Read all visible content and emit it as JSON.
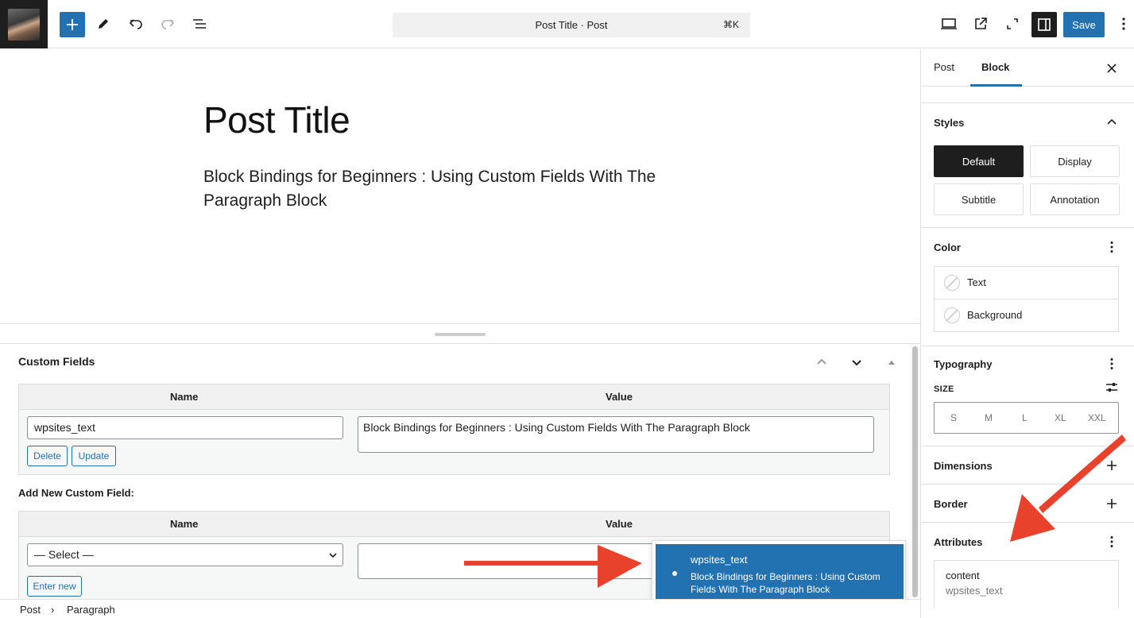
{
  "toolbar": {
    "command_title": "Post Title · Post",
    "command_shortcut": "⌘K",
    "save_label": "Save"
  },
  "editor": {
    "post_title": "Post Title",
    "paragraph": "Block Bindings for Beginners : Using Custom Fields With The Paragraph Block"
  },
  "metabox": {
    "title": "Custom Fields",
    "name_header": "Name",
    "value_header": "Value",
    "existing_field": {
      "name": "wpsites_text",
      "value": "Block Bindings for Beginners : Using Custom Fields With The Paragraph Block",
      "delete_label": "Delete",
      "update_label": "Update"
    },
    "add_new_label": "Add New Custom Field:",
    "new_field": {
      "select_value": "— Select —",
      "enter_new_label": "Enter new"
    }
  },
  "popover": {
    "key": "wpsites_text",
    "value": "Block Bindings for Beginners : Using Custom Fields With The Paragraph Block"
  },
  "breadcrumb": {
    "items": [
      "Post",
      "Paragraph"
    ],
    "separator": "›"
  },
  "sidebar": {
    "tabs": [
      "Post",
      "Block"
    ],
    "active_tab": "Block",
    "styles": {
      "title": "Styles",
      "options": [
        "Default",
        "Display",
        "Subtitle",
        "Annotation"
      ],
      "active": "Default"
    },
    "color": {
      "title": "Color",
      "items": [
        "Text",
        "Background"
      ]
    },
    "typography": {
      "title": "Typography",
      "size_label": "SIZE",
      "sizes": [
        "S",
        "M",
        "L",
        "XL",
        "XXL"
      ]
    },
    "dimensions_title": "Dimensions",
    "border_title": "Border",
    "attributes": {
      "title": "Attributes",
      "key": "content",
      "value": "wpsites_text"
    }
  },
  "colors": {
    "accent": "#2271b1",
    "annotation_arrow": "#e8412c",
    "dark": "#1e1e1e"
  }
}
